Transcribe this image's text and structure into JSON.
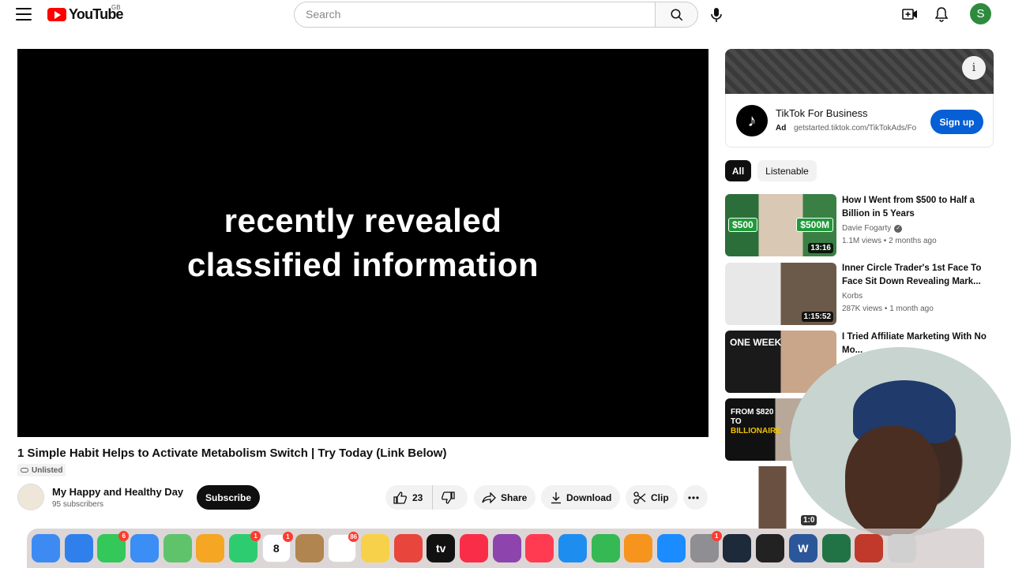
{
  "header": {
    "logo_text": "YouTube",
    "region": "GB",
    "search_placeholder": "Search",
    "avatar_letter": "S"
  },
  "player": {
    "caption_line1": "recently revealed",
    "caption_line2": "classified information"
  },
  "video": {
    "title": "1 Simple Habit Helps to Activate Metabolism Switch | Try Today (Link Below)",
    "visibility": "Unlisted",
    "channel_name": "My Happy and Healthy Day",
    "subscribers": "95 subscribers",
    "subscribe_label": "Subscribe",
    "likes": "23",
    "share_label": "Share",
    "download_label": "Download",
    "clip_label": "Clip"
  },
  "ad": {
    "title": "TikTok For Business",
    "tag": "Ad",
    "url": "getstarted.tiktok.com/TikTokAds/Fo",
    "cta": "Sign up"
  },
  "chips": [
    "All",
    "Listenable"
  ],
  "recommendations": [
    {
      "title": "How I Went from $500 to Half a Billion in 5 Years",
      "channel": "Davie Fogarty",
      "verified": true,
      "views": "1.1M views",
      "age": "2 months ago",
      "duration": "13:16",
      "thumb_tags": [
        "$500",
        "$500M"
      ]
    },
    {
      "title": "Inner Circle Trader's 1st Face To Face Sit Down Revealing Mark...",
      "channel": "Korbs",
      "verified": false,
      "views": "287K views",
      "age": "1 month ago",
      "duration": "1:15:52"
    },
    {
      "title": "I Tried Affiliate Marketing With No Mo...",
      "thumb_label": "ONE WEEK"
    },
    {
      "thumb_label_line1": "FROM $820",
      "thumb_label_line2": "TO",
      "thumb_label_line3": "BILLIONAIRE"
    },
    {
      "duration": "1:0"
    }
  ],
  "dock": {
    "apps": [
      {
        "name": "finder",
        "color": "#3d8bf2"
      },
      {
        "name": "safari",
        "color": "#2f80ed"
      },
      {
        "name": "messages",
        "color": "#34c759",
        "badge": "6"
      },
      {
        "name": "mail",
        "color": "#3a8ef6"
      },
      {
        "name": "maps",
        "color": "#5fc36b"
      },
      {
        "name": "photos",
        "color": "#f5a623"
      },
      {
        "name": "facetime",
        "color": "#2ecc71",
        "badge": "1"
      },
      {
        "name": "calendar",
        "color": "#ffffff",
        "badge": "1",
        "text": "8"
      },
      {
        "name": "contacts",
        "color": "#b08550"
      },
      {
        "name": "reminders",
        "color": "#ffffff",
        "badge": "86"
      },
      {
        "name": "notes",
        "color": "#f7d14a"
      },
      {
        "name": "chrome",
        "color": "#e8453c"
      },
      {
        "name": "tv",
        "color": "#111111",
        "text": "tv"
      },
      {
        "name": "music",
        "color": "#fa2d48"
      },
      {
        "name": "podcasts",
        "color": "#8e44ad"
      },
      {
        "name": "news",
        "color": "#ff3b52"
      },
      {
        "name": "keynote",
        "color": "#1d8ef0"
      },
      {
        "name": "numbers",
        "color": "#34b954"
      },
      {
        "name": "pages",
        "color": "#f7941d"
      },
      {
        "name": "app-store",
        "color": "#1a8cff"
      },
      {
        "name": "settings",
        "color": "#8e8e93",
        "badge": "1"
      },
      {
        "name": "quicktime",
        "color": "#1c2a3a"
      },
      {
        "name": "final-cut",
        "color": "#222222"
      },
      {
        "name": "word",
        "color": "#2b579a",
        "text": "W"
      },
      {
        "name": "excel",
        "color": "#217346"
      },
      {
        "name": "photo-booth",
        "color": "#c0392b"
      },
      {
        "name": "trash",
        "color": "#d0d0d0"
      }
    ]
  }
}
